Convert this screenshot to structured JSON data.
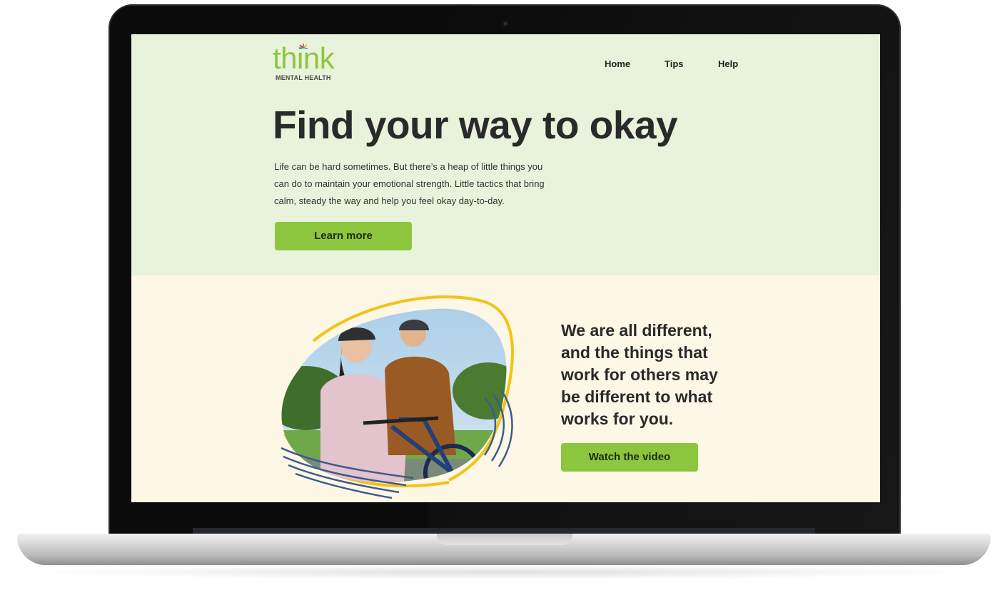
{
  "logo": {
    "word": "think",
    "subtitle": "MENTAL HEALTH"
  },
  "nav": {
    "items": [
      "Home",
      "Tips",
      "Help"
    ]
  },
  "hero": {
    "headline": "Find your way to okay",
    "intro_lines": [
      "Life can be hard sometimes. But there’s a heap of little things you",
      "can do to maintain your emotional strength. Little tactics that bring",
      "calm, steady the way and help you feel okay day-to-day."
    ],
    "cta_label": "Learn more"
  },
  "feature": {
    "quote": "We are all different, and the things that work for others may be different to what works for you.",
    "cta_label": "Watch the video",
    "image_icon": "photo-two-cyclists"
  },
  "colors": {
    "accent_green": "#8cc63f",
    "hero_bg": "#e9f2da",
    "feature_bg": "#fdf7e6",
    "yellow_outline": "#f2c318",
    "wave_blue": "#3d5a8c"
  }
}
